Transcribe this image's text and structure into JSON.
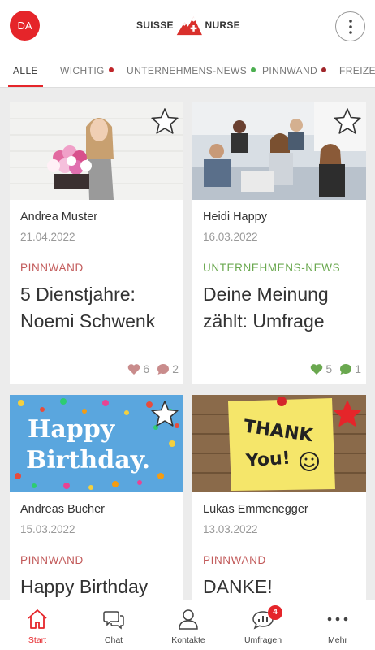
{
  "header": {
    "avatar_initials": "DA",
    "logo_left": "SUISSE",
    "logo_right": "NURSE"
  },
  "tabs": [
    {
      "label": "ALLE",
      "active": true
    },
    {
      "label": "WICHTIG",
      "dot_color": "#c0262a"
    },
    {
      "label": "UNTERNEHMENS-NEWS",
      "dot_color": "#4caf50"
    },
    {
      "label": "PINNWAND",
      "dot_color": "#a0262a"
    },
    {
      "label": "FREIZEIT"
    }
  ],
  "colors": {
    "accent": "#e5252a",
    "pinnwand": "#c25a5a",
    "news": "#6aa84f"
  },
  "cards": [
    {
      "author": "Andrea Muster",
      "date": "21.04.2022",
      "category": "PINNWAND",
      "title": "5 Dienstjahre: Noemi Schwenk",
      "likes": "6",
      "comments": "2",
      "starred": false,
      "image": "woman-with-flowers-photo"
    },
    {
      "author": "Heidi Happy",
      "date": "16.03.2022",
      "category": "UNTERNEHMENS-NEWS",
      "title": "Deine Meinung zählt: Umfrage",
      "likes": "5",
      "comments": "1",
      "starred": false,
      "image": "office-meeting-photo"
    },
    {
      "author": "Andreas Bucher",
      "date": "15.03.2022",
      "category": "PINNWAND",
      "title": "Happy Birthday",
      "starred": false,
      "image": "happy-birthday-confetti",
      "image_text_1": "Happy",
      "image_text_2": "Birthday."
    },
    {
      "author": "Lukas Emmenegger",
      "date": "13.03.2022",
      "category": "PINNWAND",
      "title": "DANKE!",
      "starred": true,
      "image": "thank-you-note",
      "image_text_1": "THANK",
      "image_text_2": "You!"
    }
  ],
  "bottom_nav": [
    {
      "label": "Start",
      "icon": "home-icon",
      "active": true
    },
    {
      "label": "Chat",
      "icon": "chat-icon"
    },
    {
      "label": "Kontakte",
      "icon": "contacts-icon"
    },
    {
      "label": "Umfragen",
      "icon": "survey-icon",
      "badge": "4"
    },
    {
      "label": "Mehr",
      "icon": "more-icon"
    }
  ]
}
